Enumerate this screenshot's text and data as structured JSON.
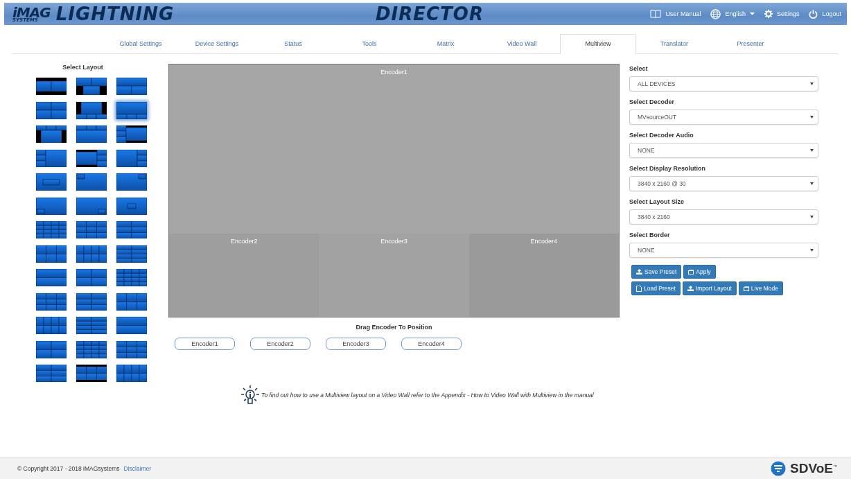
{
  "header": {
    "logo_brand": "iMAG",
    "logo_sub": "SYSTEMS",
    "product": "LIGHTNING",
    "title": "DIRECTOR",
    "links": [
      {
        "kind": "manual",
        "label": "User Manual"
      },
      {
        "kind": "language",
        "label": "English"
      },
      {
        "kind": "settings",
        "label": "Settings"
      },
      {
        "kind": "logout",
        "label": "Logout"
      }
    ]
  },
  "tabs": [
    {
      "label": "Global Settings",
      "selected": false
    },
    {
      "label": "Device Settings",
      "selected": false
    },
    {
      "label": "Status",
      "selected": false
    },
    {
      "label": "Tools",
      "selected": false
    },
    {
      "label": "Matrix",
      "selected": false
    },
    {
      "label": "Video Wall",
      "selected": false
    },
    {
      "label": "Multiview",
      "selected": true
    },
    {
      "label": "Translator",
      "selected": false
    },
    {
      "label": "Presenter",
      "selected": false
    }
  ],
  "layout_picker": {
    "title": "Select Layout",
    "layouts": [
      {
        "selected": false
      },
      {
        "selected": false
      },
      {
        "selected": false
      },
      {
        "selected": false
      },
      {
        "selected": false
      },
      {
        "selected": true
      },
      {
        "selected": false
      },
      {
        "selected": false
      },
      {
        "selected": false
      },
      {
        "selected": false
      },
      {
        "selected": false
      },
      {
        "selected": false
      },
      {
        "selected": false
      },
      {
        "selected": false
      },
      {
        "selected": false
      },
      {
        "selected": false
      },
      {
        "selected": false
      },
      {
        "selected": false
      },
      {
        "selected": false
      },
      {
        "selected": false
      },
      {
        "selected": false
      },
      {
        "selected": false
      },
      {
        "selected": false
      },
      {
        "selected": false
      },
      {
        "selected": false
      },
      {
        "selected": false
      },
      {
        "selected": false
      },
      {
        "selected": false
      },
      {
        "selected": false
      },
      {
        "selected": false
      },
      {
        "selected": false
      },
      {
        "selected": false
      },
      {
        "selected": false
      },
      {
        "selected": false
      },
      {
        "selected": false
      },
      {
        "selected": false
      },
      {
        "selected": false
      },
      {
        "selected": false
      },
      {
        "selected": false
      }
    ]
  },
  "preview": {
    "regions": [
      {
        "label": "Encoder1",
        "kind": "main"
      },
      {
        "label": "Encoder2",
        "kind": "sub"
      },
      {
        "label": "Encoder3",
        "kind": "sub"
      },
      {
        "label": "Encoder4",
        "kind": "sub"
      }
    ],
    "drag_title": "Drag Encoder To Position",
    "encoders": [
      "Encoder1",
      "Encoder2",
      "Encoder3",
      "Encoder4"
    ]
  },
  "settings": [
    {
      "label": "Select",
      "value": "ALL DEVICES"
    },
    {
      "label": "Select Decoder",
      "value": "MVsourceOUT"
    },
    {
      "label": "Select Decoder Audio",
      "value": "NONE"
    },
    {
      "label": "Select Display Resolution",
      "value": "3840 x 2160 @ 30"
    },
    {
      "label": "Select Layout Size",
      "value": "3840 x 2160"
    },
    {
      "label": "Select Border",
      "value": "NONE"
    }
  ],
  "button_rows": [
    [
      {
        "kind": "upload",
        "label": "Save Preset"
      },
      {
        "kind": "square",
        "label": "Apply"
      }
    ],
    [
      {
        "kind": "file",
        "label": "Load Preset"
      },
      {
        "kind": "upload",
        "label": "Import Layout"
      },
      {
        "kind": "square",
        "label": "Live Mode"
      }
    ]
  ],
  "tip": "To find out how to use a Multiview layout on a Video Wall refer to the Appendix - How to Video Wall with Multiview in the manual",
  "footer": {
    "copyright": "© Copyright 2017 - 2018 iMAGsystems",
    "link": "Disclaimer",
    "brand": "SDVoE",
    "brand_mark": "™"
  }
}
